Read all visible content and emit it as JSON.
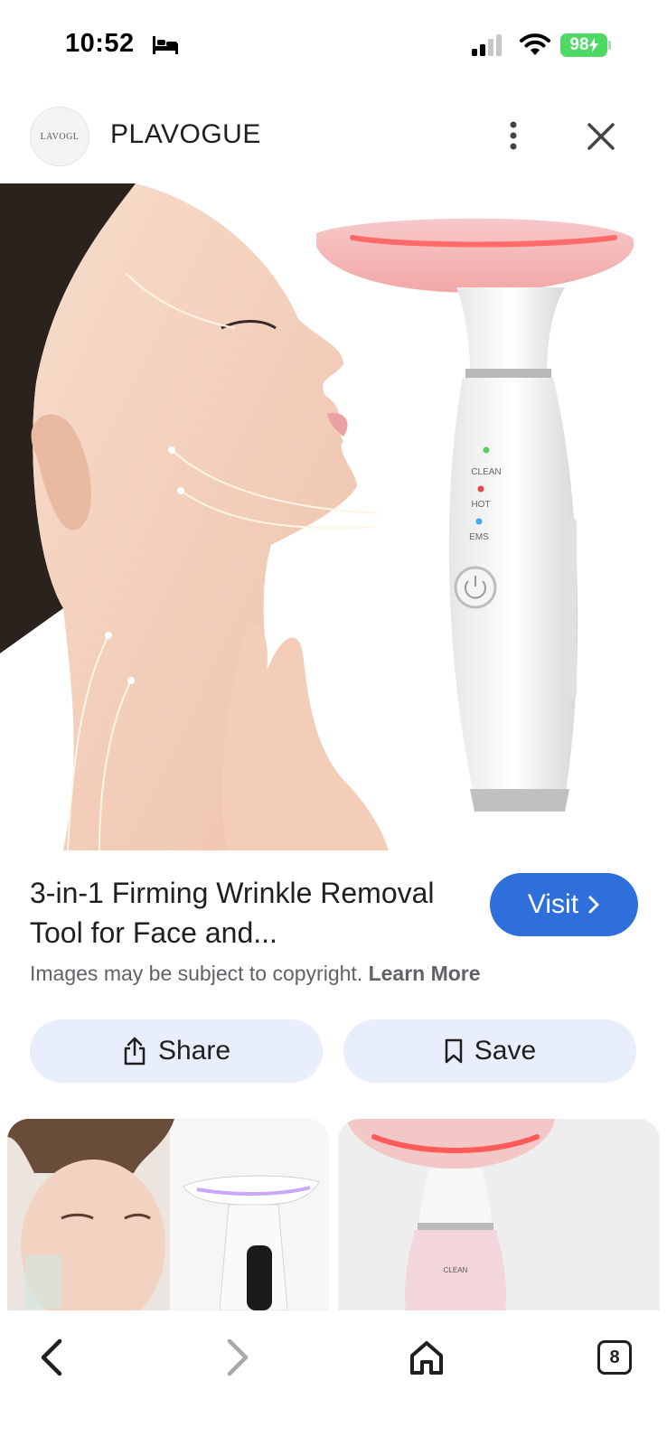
{
  "status": {
    "time": "10:52",
    "battery": "98"
  },
  "header": {
    "avatar_text": "LAVOGL",
    "site": "PLAVOGUE"
  },
  "product_image": {
    "device_labels": [
      "CLEAN",
      "HOT",
      "EMS"
    ]
  },
  "info": {
    "title": "3-in-1 Firming Wrinkle Removal Tool for Face and...",
    "visit_label": "Visit",
    "copyright": "Images may be subject to copyright.",
    "learn_more": "Learn More"
  },
  "actions": {
    "share_label": "Share",
    "save_label": "Save"
  },
  "related": [
    {
      "device_label": "CLEAN"
    }
  ],
  "nav": {
    "tab_count": "8"
  },
  "colors": {
    "accent": "#2f6fdc",
    "action_bg": "#e8eefb",
    "battery": "#4cd964"
  },
  "icons": [
    "bed-icon",
    "signal-icon",
    "wifi-icon",
    "more-vert-icon",
    "close-icon",
    "chevron-right-icon",
    "share-icon",
    "bookmark-icon",
    "back-icon",
    "forward-icon",
    "home-icon"
  ]
}
